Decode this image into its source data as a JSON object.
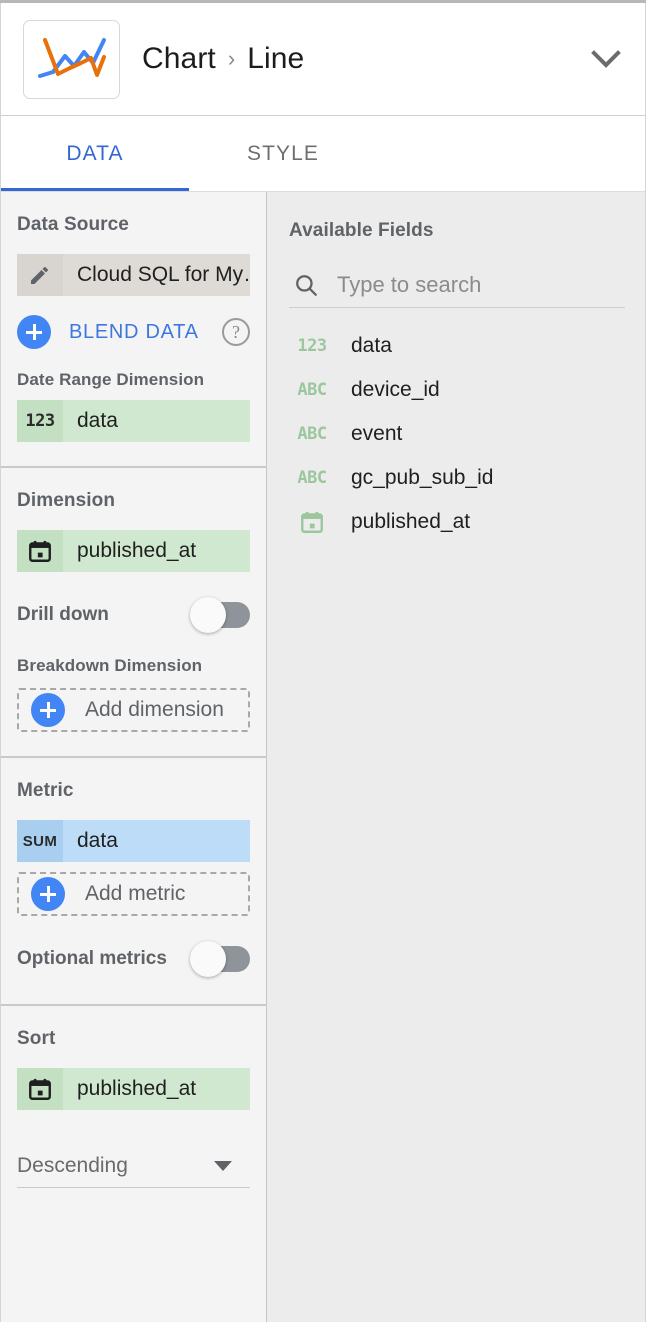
{
  "header": {
    "icon": "line-chart-icon",
    "breadcrumb_parent": "Chart",
    "breadcrumb_separator": "›",
    "breadcrumb_current": "Line",
    "chevron": "chevron-down-icon"
  },
  "tabs": [
    {
      "label": "DATA",
      "active": true
    },
    {
      "label": "STYLE",
      "active": false
    }
  ],
  "left": {
    "data_source": {
      "title": "Data Source",
      "chip": {
        "icon": "pencil-icon",
        "name": "Cloud SQL for My…"
      },
      "blend_label": "BLEND DATA",
      "blend_icon": "plus-circle-icon",
      "help_icon": "help-circle-icon",
      "help_glyph": "?",
      "date_range_label": "Date Range Dimension",
      "date_range_chip": {
        "type": "123",
        "name": "data"
      }
    },
    "dimension": {
      "title": "Dimension",
      "chip": {
        "type": "calendar-icon",
        "name": "published_at"
      },
      "drill_down_label": "Drill down",
      "drill_down_on": false,
      "breakdown_label": "Breakdown Dimension",
      "add_dimension_label": "Add dimension"
    },
    "metric": {
      "title": "Metric",
      "chip": {
        "type": "SUM",
        "name": "data"
      },
      "add_metric_label": "Add metric",
      "optional_metrics_label": "Optional metrics",
      "optional_metrics_on": false
    },
    "sort": {
      "title": "Sort",
      "chip": {
        "type": "calendar-icon",
        "name": "published_at"
      },
      "order_value": "Descending"
    }
  },
  "right": {
    "title": "Available Fields",
    "search_placeholder": "Type to search",
    "search_value": "",
    "search_icon": "search-icon",
    "fields": [
      {
        "type": "123",
        "name": "data"
      },
      {
        "type": "ABC",
        "name": "device_id"
      },
      {
        "type": "ABC",
        "name": "event"
      },
      {
        "type": "ABC",
        "name": "gc_pub_sub_id"
      },
      {
        "type": "calendar-icon",
        "name": "published_at"
      }
    ]
  },
  "colors": {
    "accent_blue": "#3367d6",
    "plus_blue": "#4285f4",
    "chip_green": "#cfe8cf",
    "chip_green_icon": "#c3e0c3",
    "chip_blue": "#bddcf7",
    "chip_blue_icon": "#a8cfef",
    "chip_grey": "#dedbd6",
    "field_icon_green": "#9cc79c",
    "left_pane_bg": "#f4f4f4",
    "right_pane_bg": "#ececec",
    "line_orange": "#e8710a",
    "line_blue": "#4285f4"
  }
}
